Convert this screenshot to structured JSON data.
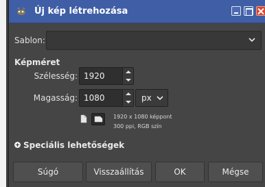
{
  "window": {
    "title": "Új kép létrehozása"
  },
  "template": {
    "label": "Sablon:",
    "value": ""
  },
  "image_size": {
    "section_label": "Képméret",
    "width_label": "Szélesség:",
    "width_value": "1920",
    "height_label": "Magasság:",
    "height_value": "1080",
    "unit": "px",
    "info_line1": "1920 x 1080 képpont",
    "info_line2": "300 ppi, RGB szín"
  },
  "advanced": {
    "label": "Speciális lehetőségek"
  },
  "buttons": {
    "help": "Súgó",
    "reset": "Visszaállítás",
    "ok": "OK",
    "cancel": "Mégse"
  },
  "colors": {
    "titlebar": "#3f5ea6",
    "dialog_bg": "#454545",
    "close_button": "#d9472f"
  }
}
